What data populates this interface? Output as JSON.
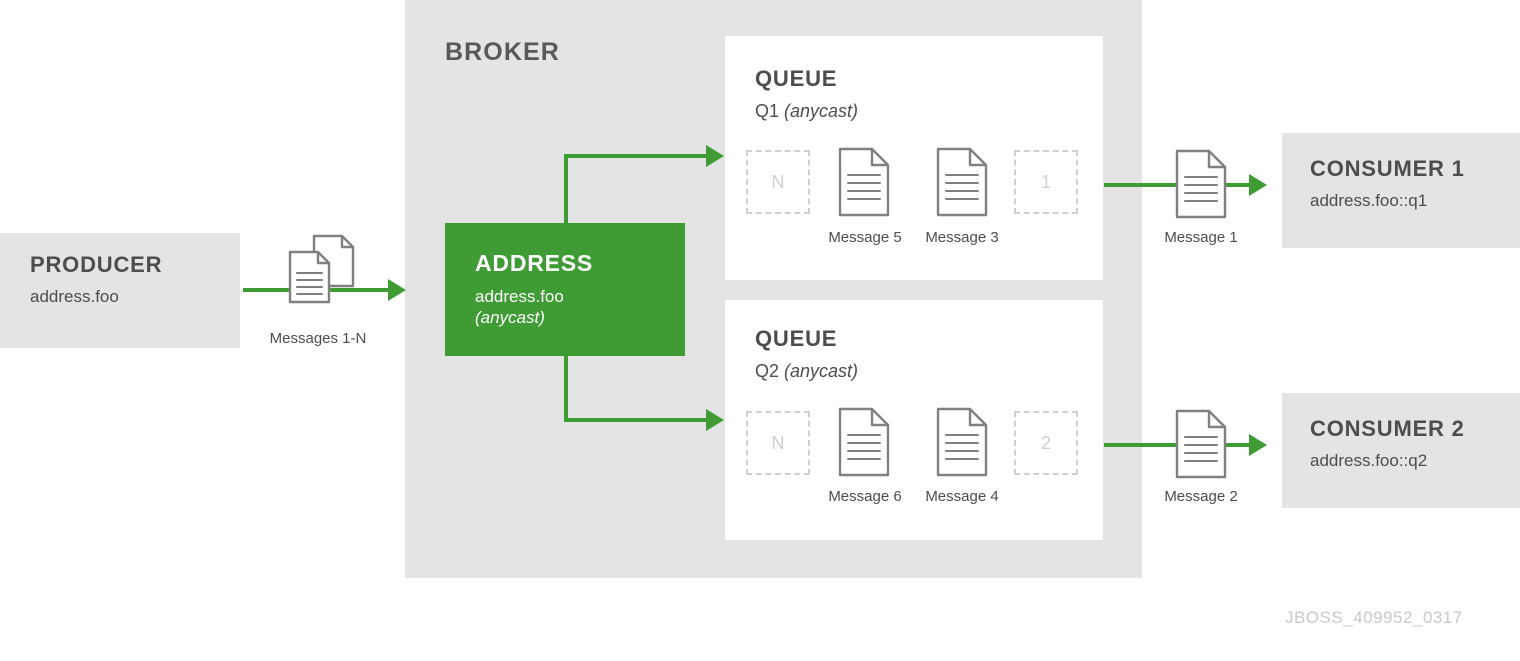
{
  "diagram": {
    "broker": {
      "label": "BROKER"
    },
    "footer_code": "JBOSS_409952_0317",
    "colors": {
      "green": "#3f9c35",
      "grey_box": "#e4e4e4",
      "text_dark": "#4d4d4d",
      "placeholder_grey": "#cfcfcf"
    },
    "producer": {
      "title": "PRODUCER",
      "subtitle": "address.foo",
      "flow_label": "Messages 1-N",
      "icon": "stacked-documents-icon"
    },
    "address": {
      "title": "ADDRESS",
      "name": "address.foo",
      "routing_type": "(anycast)"
    },
    "queues": [
      {
        "title": "QUEUE",
        "name": "Q1",
        "routing_type": "(anycast)",
        "slots": [
          {
            "type": "placeholder",
            "label": "N"
          },
          {
            "type": "message",
            "label": "Message 5",
            "icon": "document-icon"
          },
          {
            "type": "message",
            "label": "Message 3",
            "icon": "document-icon"
          },
          {
            "type": "placeholder",
            "label": "1"
          }
        ]
      },
      {
        "title": "QUEUE",
        "name": "Q2",
        "routing_type": "(anycast)",
        "slots": [
          {
            "type": "placeholder",
            "label": "N"
          },
          {
            "type": "message",
            "label": "Message 6",
            "icon": "document-icon"
          },
          {
            "type": "message",
            "label": "Message 4",
            "icon": "document-icon"
          },
          {
            "type": "placeholder",
            "label": "2"
          }
        ]
      }
    ],
    "consumers": [
      {
        "title": "CONSUMER 1",
        "subtitle": "address.foo::q1",
        "flow_label": "Message 1",
        "icon": "document-icon"
      },
      {
        "title": "CONSUMER 2",
        "subtitle": "address.foo::q2",
        "flow_label": "Message 2",
        "icon": "document-icon"
      }
    ]
  }
}
